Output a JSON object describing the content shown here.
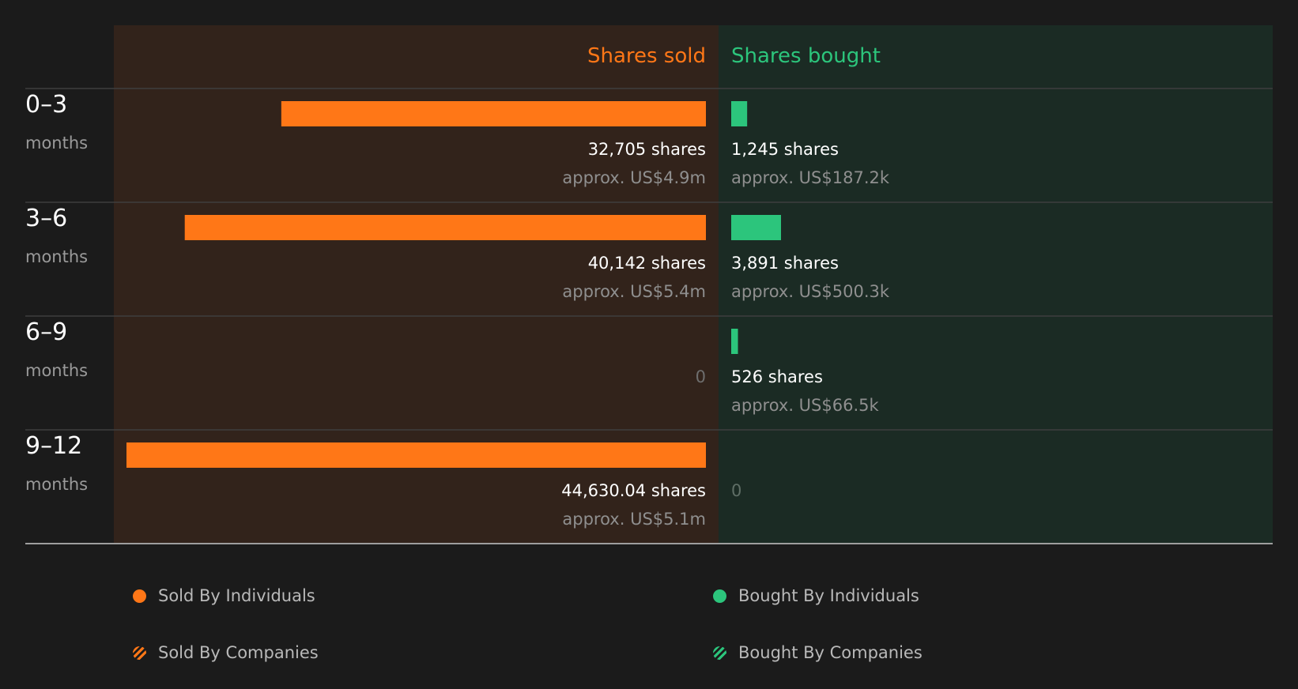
{
  "chart_data": {
    "type": "bar",
    "sold_header": "Shares sold",
    "bought_header": "Shares bought",
    "colors": {
      "sold": "#ff7717",
      "bought": "#2cc57c",
      "sold_panel": "#32231b",
      "bought_panel": "#1b2b24",
      "background": "#1b1b1b"
    },
    "categories": [
      {
        "range": "0–3",
        "unit": "months"
      },
      {
        "range": "3–6",
        "unit": "months"
      },
      {
        "range": "6–9",
        "unit": "months"
      },
      {
        "range": "9–12",
        "unit": "months"
      }
    ],
    "series": [
      {
        "name": "Shares sold",
        "values": [
          32705,
          40142,
          0,
          44630.04
        ],
        "labels": [
          "32,705 shares",
          "40,142 shares",
          "0",
          "44,630.04 shares"
        ],
        "values_usd": [
          "approx. US$4.9m",
          "approx. US$5.4m",
          "",
          "approx. US$5.1m"
        ]
      },
      {
        "name": "Shares bought",
        "values": [
          1245,
          3891,
          526,
          0
        ],
        "labels": [
          "1,245 shares",
          "3,891 shares",
          "526 shares",
          "0"
        ],
        "values_usd": [
          "approx. US$187.2k",
          "approx. US$500.3k",
          "approx. US$66.5k",
          ""
        ]
      }
    ],
    "legend": [
      {
        "label": "Sold By Individuals",
        "marker": "dot",
        "color": "#ff7717"
      },
      {
        "label": "Bought By Individuals",
        "marker": "dot",
        "color": "#2cc57c"
      },
      {
        "label": "Sold By Companies",
        "marker": "hatched-dot",
        "color": "#ff7717"
      },
      {
        "label": "Bought By Companies",
        "marker": "hatched-dot",
        "color": "#2cc57c"
      }
    ]
  }
}
